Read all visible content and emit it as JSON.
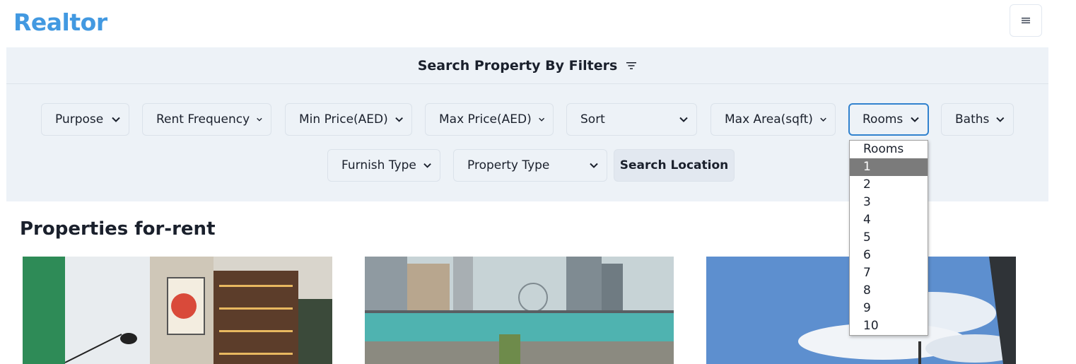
{
  "brand": "Realtor",
  "filters": {
    "header": "Search Property By Filters",
    "purpose": "Purpose",
    "rent_frequency": "Rent Frequency",
    "min_price": "Min Price(AED)",
    "max_price": "Max Price(AED)",
    "sort": "Sort",
    "max_area": "Max Area(sqft)",
    "rooms": "Rooms",
    "baths": "Baths",
    "furnish_type": "Furnish Type",
    "property_type": "Property Type",
    "search_location": "Search Location"
  },
  "rooms_dropdown": {
    "options": [
      "Rooms",
      "1",
      "2",
      "3",
      "4",
      "5",
      "6",
      "7",
      "8",
      "9",
      "10"
    ],
    "highlighted": "1"
  },
  "properties": {
    "title": "Properties for-rent"
  },
  "colors": {
    "brand": "#4299e1",
    "panel": "#edf2f7",
    "focus": "#3182ce",
    "highlight": "#7b7b7b"
  },
  "icons": [
    "hamburger-icon",
    "filter-icon",
    "chevron-down-icon"
  ]
}
